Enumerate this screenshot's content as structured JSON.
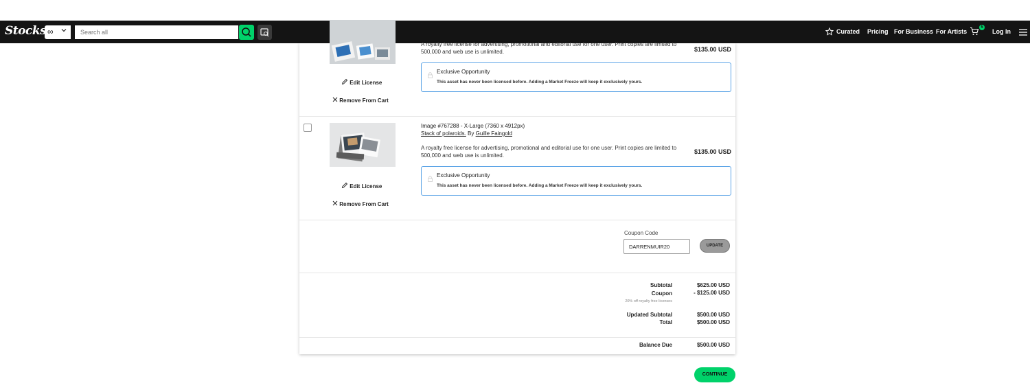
{
  "nav": {
    "logo": "Stocksy",
    "filter_symbol": "∞",
    "search_placeholder": "Search all",
    "curated": "Curated",
    "pricing": "Pricing",
    "for_business": "For Business",
    "for_artists": "For Artists",
    "cart_count": "5",
    "login": "Log In"
  },
  "cart_items": [
    {
      "description": "A royalty free license for advertising, promotional and editorial use for one user. Print copies are limited to 500,000 and web use is unlimited.",
      "price": "$135.00 USD",
      "exclusive_title": "Exclusive Opportunity",
      "exclusive_text": "This asset has never been licensed before. Adding a Market Freeze will keep it exclusively yours.",
      "edit_license": "Edit License",
      "remove": "Remove From Cart"
    },
    {
      "image_line": "Image #767288 - X-Large (7360 x 4912px)",
      "asset_title": "Stack of polaroids.",
      "by": "By",
      "author": "Guille Faingold",
      "description": "A royalty free license for advertising, promotional and editorial use for one user. Print copies are limited to 500,000 and web use is unlimited.",
      "price": "$135.00 USD",
      "exclusive_title": "Exclusive Opportunity",
      "exclusive_text": "This asset has never been licensed before. Adding a Market Freeze will keep it exclusively yours.",
      "edit_license": "Edit License",
      "remove": "Remove From Cart"
    }
  ],
  "coupon": {
    "label": "Coupon Code",
    "value": "DARRENMUIR20",
    "update": "UPDATE"
  },
  "summary": {
    "subtotal_label": "Subtotal",
    "subtotal": "$625.00 USD",
    "coupon_label": "Coupon",
    "coupon": "- $125.00 USD",
    "coupon_note": "20% off royalty free licenses",
    "updated_subtotal_label": "Updated Subtotal",
    "updated_subtotal": "$500.00 USD",
    "total_label": "Total",
    "total": "$500.00 USD",
    "balance_label": "Balance Due",
    "balance": "$500.00 USD"
  },
  "continue": "CONTINUE",
  "colors": {
    "accent": "#00d26a",
    "navbar": "#141414",
    "exclusive_border": "#5aa3e6"
  }
}
